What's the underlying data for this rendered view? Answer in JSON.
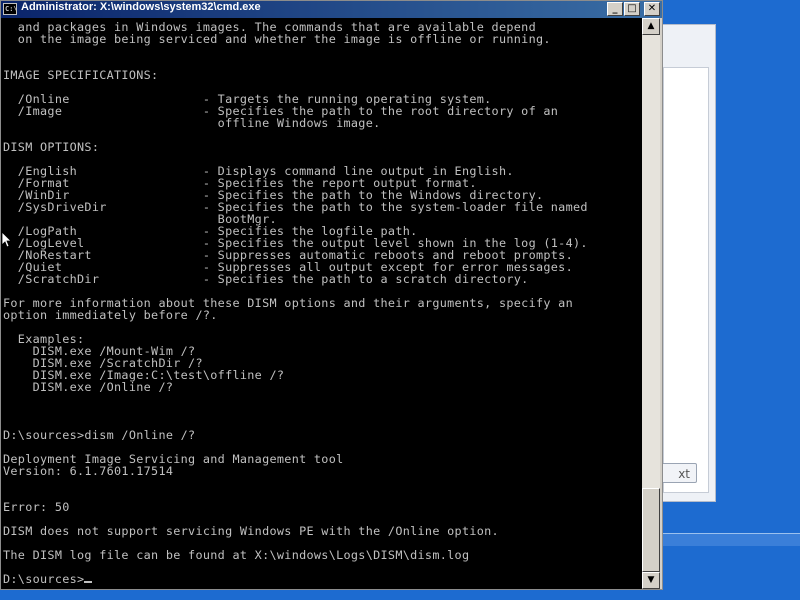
{
  "window": {
    "title": "Administrator: X:\\windows\\system32\\cmd.exe",
    "icon_label": "C:\\",
    "buttons": {
      "minimize": "_",
      "maximize": "□",
      "close": "✕"
    }
  },
  "console": {
    "lines": [
      "  and packages in Windows images. The commands that are available depend",
      "  on the image being serviced and whether the image is offline or running.",
      "",
      "",
      "IMAGE SPECIFICATIONS:",
      "",
      "  /Online                  - Targets the running operating system.",
      "  /Image                   - Specifies the path to the root directory of an",
      "                             offline Windows image.",
      "",
      "DISM OPTIONS:",
      "",
      "  /English                 - Displays command line output in English.",
      "  /Format                  - Specifies the report output format.",
      "  /WinDir                  - Specifies the path to the Windows directory.",
      "  /SysDriveDir             - Specifies the path to the system-loader file named",
      "                             BootMgr.",
      "  /LogPath                 - Specifies the logfile path.",
      "  /LogLevel                - Specifies the output level shown in the log (1-4).",
      "  /NoRestart               - Suppresses automatic reboots and reboot prompts.",
      "  /Quiet                   - Suppresses all output except for error messages.",
      "  /ScratchDir              - Specifies the path to a scratch directory.",
      "",
      "For more information about these DISM options and their arguments, specify an",
      "option immediately before /?.",
      "",
      "  Examples:",
      "    DISM.exe /Mount-Wim /?",
      "    DISM.exe /ScratchDir /?",
      "    DISM.exe /Image:C:\\test\\offline /?",
      "    DISM.exe /Online /?",
      "",
      "",
      "",
      "D:\\sources>dism /Online /?",
      "",
      "Deployment Image Servicing and Management tool",
      "Version: 6.1.7601.17514",
      "",
      "",
      "Error: 50",
      "",
      "DISM does not support servicing Windows PE with the /Online option.",
      "",
      "The DISM log file can be found at X:\\windows\\Logs\\DISM\\dism.log",
      "",
      "D:\\sources>"
    ]
  },
  "background_window": {
    "button_label": "xt"
  },
  "colors": {
    "desktop": "#1d6bd0",
    "titlebar_start": "#0a246a",
    "titlebar_end": "#3a6ea5",
    "console_bg": "#000000",
    "console_text": "#c0c0c0"
  }
}
